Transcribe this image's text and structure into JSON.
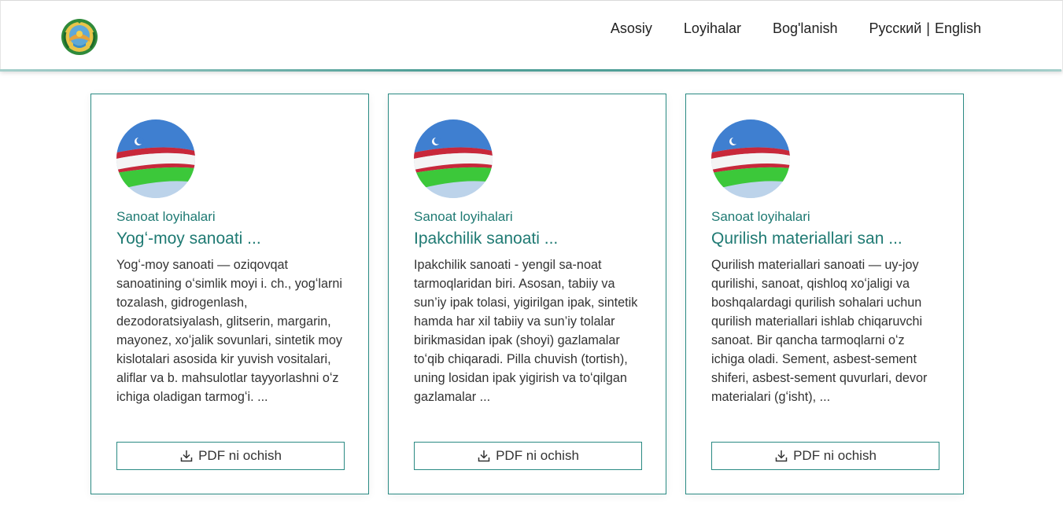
{
  "nav": {
    "items": [
      "Asosiy",
      "Loyihalar",
      "Bog'lanish"
    ],
    "lang_ru": "Русский",
    "lang_sep": "|",
    "lang_en": "English"
  },
  "cards": [
    {
      "category": "Sanoat loyihalari",
      "title": "Yogʻ-moy sanoati ...",
      "description": "Yogʻ-moy sanoati — oziqovqat sanoatining oʻsimlik moyi i. ch., yogʻlarni tozalash, gidrogenlash, dezodoratsiyalash, glitserin, margarin, mayonez, xoʻjalik sovunlari, sintetik moy kislotalari asosida kir yuvish vositalari, aliflar va b. mahsulotlar tayyorlashni oʻz ichiga oladigan tarmogʻi. ...",
      "button": "PDF ni ochish"
    },
    {
      "category": "Sanoat loyihalari",
      "title": "Ipakchilik sanoati ...",
      "description": "Ipakchilik sanoati - yengil sa-noat tarmoqlaridan biri. Asosan, tabiiy va sun’iy ipak tolasi, yigirilgan ipak, sintetik hamda har xil tabiiy va sun’iy tolalar birikmasidan ipak (shoyi) gazlamalar toʻqib chiqaradi. Pilla chuvish (tortish), uning losidan ipak yigirish va toʻqilgan gazlamalar ...",
      "button": "PDF ni ochish"
    },
    {
      "category": "Sanoat loyihalari",
      "title": "Qurilish materiallari san ...",
      "description": "Qurilish materiallari sanoati — uy-joy qurilishi, sanoat, qishloq xoʻjaligi va boshqalardagi qurilish sohalari uchun qurilish materiallari ishlab chiqaruvchi sanoat. Bir qancha tarmoqlarni oʻz ichiga oladi. Sement, asbest-sement shiferi, asbest-sement quvurlari, devor materialari (gʻisht), ...",
      "button": "PDF ni ochish"
    }
  ],
  "colors": {
    "accent": "#1f7a73",
    "border": "#2a8a83"
  },
  "icons": {
    "logo": "uzbekistan-emblem-icon",
    "card_image": "uzbekistan-flag-image",
    "button": "download-icon"
  }
}
